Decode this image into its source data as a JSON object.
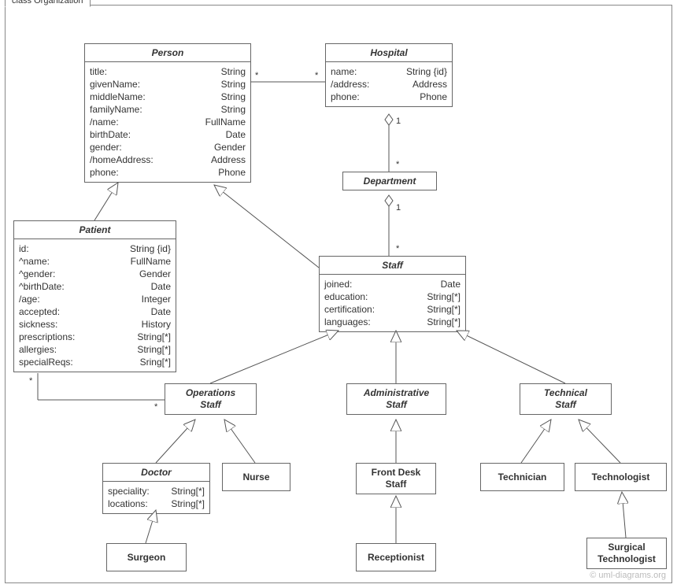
{
  "frame_title": "class Organization",
  "credit": "© uml-diagrams.org",
  "classes": {
    "person": {
      "name": "Person",
      "attrs": [
        {
          "n": "title:",
          "t": "String"
        },
        {
          "n": "givenName:",
          "t": "String"
        },
        {
          "n": "middleName:",
          "t": "String"
        },
        {
          "n": "familyName:",
          "t": "String"
        },
        {
          "n": "/name:",
          "t": "FullName"
        },
        {
          "n": "birthDate:",
          "t": "Date"
        },
        {
          "n": "gender:",
          "t": "Gender"
        },
        {
          "n": "/homeAddress:",
          "t": "Address"
        },
        {
          "n": "phone:",
          "t": "Phone"
        }
      ]
    },
    "hospital": {
      "name": "Hospital",
      "attrs": [
        {
          "n": "name:",
          "t": "String {id}"
        },
        {
          "n": "/address:",
          "t": "Address"
        },
        {
          "n": "phone:",
          "t": "Phone"
        }
      ]
    },
    "department": {
      "name": "Department"
    },
    "patient": {
      "name": "Patient",
      "attrs": [
        {
          "n": "id:",
          "t": "String {id}"
        },
        {
          "n": "^name:",
          "t": "FullName"
        },
        {
          "n": "^gender:",
          "t": "Gender"
        },
        {
          "n": "^birthDate:",
          "t": "Date"
        },
        {
          "n": "/age:",
          "t": "Integer"
        },
        {
          "n": "accepted:",
          "t": "Date"
        },
        {
          "n": "sickness:",
          "t": "History"
        },
        {
          "n": "prescriptions:",
          "t": "String[*]"
        },
        {
          "n": "allergies:",
          "t": "String[*]"
        },
        {
          "n": "specialReqs:",
          "t": "Sring[*]"
        }
      ]
    },
    "staff": {
      "name": "Staff",
      "attrs": [
        {
          "n": "joined:",
          "t": "Date"
        },
        {
          "n": "education:",
          "t": "String[*]"
        },
        {
          "n": "certification:",
          "t": "String[*]"
        },
        {
          "n": "languages:",
          "t": "String[*]"
        }
      ]
    },
    "opstaff": {
      "name": "Operations",
      "name2": "Staff"
    },
    "admstaff": {
      "name": "Administrative",
      "name2": "Staff"
    },
    "techstaff": {
      "name": "Technical",
      "name2": "Staff"
    },
    "doctor": {
      "name": "Doctor",
      "attrs": [
        {
          "n": "speciality:",
          "t": "String[*]"
        },
        {
          "n": "locations:",
          "t": "String[*]"
        }
      ]
    },
    "nurse": {
      "name": "Nurse"
    },
    "frontdesk": {
      "name": "Front Desk",
      "name2": "Staff"
    },
    "receptionist": {
      "name": "Receptionist"
    },
    "technician": {
      "name": "Technician"
    },
    "technologist": {
      "name": "Technologist"
    },
    "surgtech": {
      "name": "Surgical",
      "name2": "Technologist"
    },
    "surgeon": {
      "name": "Surgeon"
    }
  },
  "mult": {
    "ph_star_l": "*",
    "ph_star_r": "*",
    "hd_1": "1",
    "hd_star": "*",
    "ds_1": "1",
    "ds_star": "*",
    "po_star": "*",
    "po_star2": "*"
  }
}
